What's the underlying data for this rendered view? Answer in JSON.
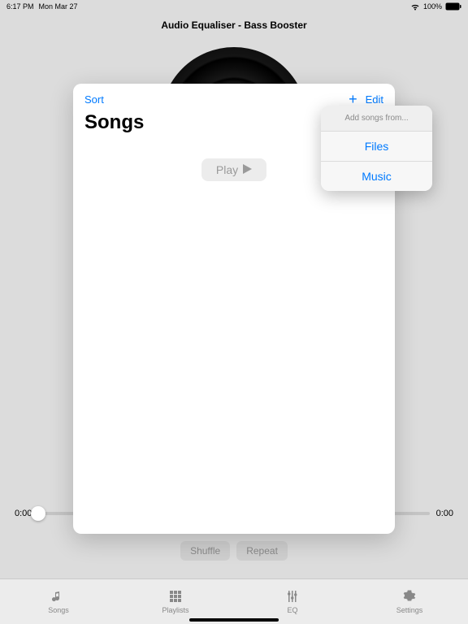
{
  "status": {
    "time": "6:17 PM",
    "date": "Mon Mar 27",
    "wifi": "wifi-icon",
    "battery_pct": "100%"
  },
  "app": {
    "title": "Audio Equaliser - Bass Booster"
  },
  "progress": {
    "start": "0:00",
    "end": "0:00"
  },
  "lower": {
    "shuffle": "Shuffle",
    "repeat": "Repeat"
  },
  "tabs": [
    {
      "label": "Songs"
    },
    {
      "label": "Playlists"
    },
    {
      "label": "EQ"
    },
    {
      "label": "Settings"
    }
  ],
  "modal": {
    "sort": "Sort",
    "edit": "Edit",
    "title": "Songs",
    "play": "Play"
  },
  "popover": {
    "title": "Add songs from...",
    "items": [
      "Files",
      "Music"
    ]
  }
}
